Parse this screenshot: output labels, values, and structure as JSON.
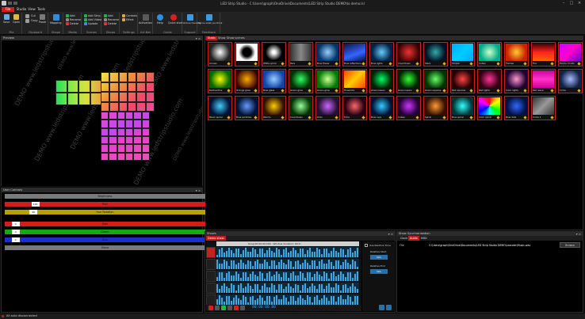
{
  "window": {
    "title": "LED Strip Studio - C:\\Users\\graph\\OneDrive\\Documents\\LED Strip Studio DEMO\\to demo.lsl"
  },
  "menu": {
    "tabs": [
      "File",
      "Studio",
      "View",
      "Tools"
    ]
  },
  "ribbon": {
    "groups": [
      {
        "label": "File",
        "buttons": [
          "Save",
          "Open"
        ]
      },
      {
        "label": "Clipboard",
        "buttons": [
          "Cut",
          "Copy",
          "Paste"
        ]
      },
      {
        "label": "Shape",
        "buttons": [
          "Mapping"
        ]
      },
      {
        "label": "Media",
        "buttons": [
          "Add",
          "Rename",
          "Delete"
        ]
      },
      {
        "label": "Scenes",
        "buttons": [
          "Add Strip",
          "Add Video",
          "Update"
        ]
      },
      {
        "label": "Shows",
        "buttons": [
          "Add",
          "Rename",
          "Delete"
        ]
      },
      {
        "label": "Settings",
        "buttons": [
          "Controls",
          "Effect"
        ]
      },
      {
        "label": "Art-Net",
        "buttons": [
          "Activation"
        ]
      },
      {
        "label": "Guide",
        "buttons": [
          "Help",
          "Quick start"
        ]
      },
      {
        "label": "Support",
        "buttons": [
          "Online training"
        ]
      },
      {
        "label": "Feedback",
        "buttons": [
          "Tell us what you think"
        ]
      }
    ]
  },
  "preview": {
    "title": "Preview",
    "watermark": "DEMO www.ledstripstudio.com"
  },
  "effects": {
    "tabs": [
      "Static",
      "Show",
      "Show scenes"
    ],
    "items": [
      "Arrows",
      "",
      "White spiral",
      "Bars",
      "Blue flower",
      "Blue reflections",
      "Blue lights",
      "Countdown",
      "Stars",
      "Stripes",
      "Cubes",
      "Flames",
      "Fire",
      "Purple clouds",
      "Radioactive",
      "Orange glow",
      "Blue glass",
      "Green glow",
      "Green glow",
      "Fireworks",
      "Green lasers",
      "Green lasers",
      "Green squares",
      "Red squares",
      "Red lights",
      "Color lights",
      "Red wave",
      "Circle",
      "Music spiral",
      "Blue particles",
      "Worms",
      "Countdown",
      "Orbs",
      "Time",
      "Blue rays",
      "Cubes",
      "Spiral",
      "Blue spiral",
      "Color spiral",
      "Blue dots",
      "Circle 1"
    ]
  },
  "user_controls": {
    "title": "User Controls",
    "rows": [
      {
        "label": "Brightness",
        "color": "#7a7a7a",
        "value": "",
        "fraction": 0
      },
      {
        "label": "Red",
        "color": "#d41c1c",
        "value": "100",
        "fraction": 0.13
      },
      {
        "label": "Hue Rotation",
        "color": "#b8a200",
        "value": "90",
        "fraction": 0.12
      },
      {
        "label": "Red",
        "color": "#d41c1c",
        "value": "0",
        "fraction": 0.02
      },
      {
        "label": "Green",
        "color": "#17a817",
        "value": "0",
        "fraction": 0.02
      },
      {
        "label": "Blue",
        "color": "#1a2ed4",
        "value": "0",
        "fraction": 0.02
      },
      {
        "label": "Mono",
        "color": "#7a7a7a",
        "value": "",
        "fraction": 0
      }
    ]
  },
  "shows": {
    "title": "Shows",
    "tabs": [
      "Demo show"
    ],
    "ruler_text": "Song 00:00:00.000 · Window duration: 00:0:",
    "timecode": "00:00:00.00",
    "use_relative_time": "Use Relative Time",
    "relative_start": "Relative Start",
    "relative_end": "Relative End",
    "relative_start_btn": "N/A",
    "relative_end_btn": "N/A"
  },
  "sync": {
    "title": "Show Synchronization",
    "tabs": [
      "Clock",
      "Audio",
      "MIDI"
    ],
    "file_label": "File",
    "file_path": "C:\\Users\\graph\\OneDrive\\Documents\\LED Strip Studio DEMO\\Leander\\Music.wav",
    "browse_label": "Browse"
  },
  "status": {
    "text": "All auto disconnected"
  }
}
